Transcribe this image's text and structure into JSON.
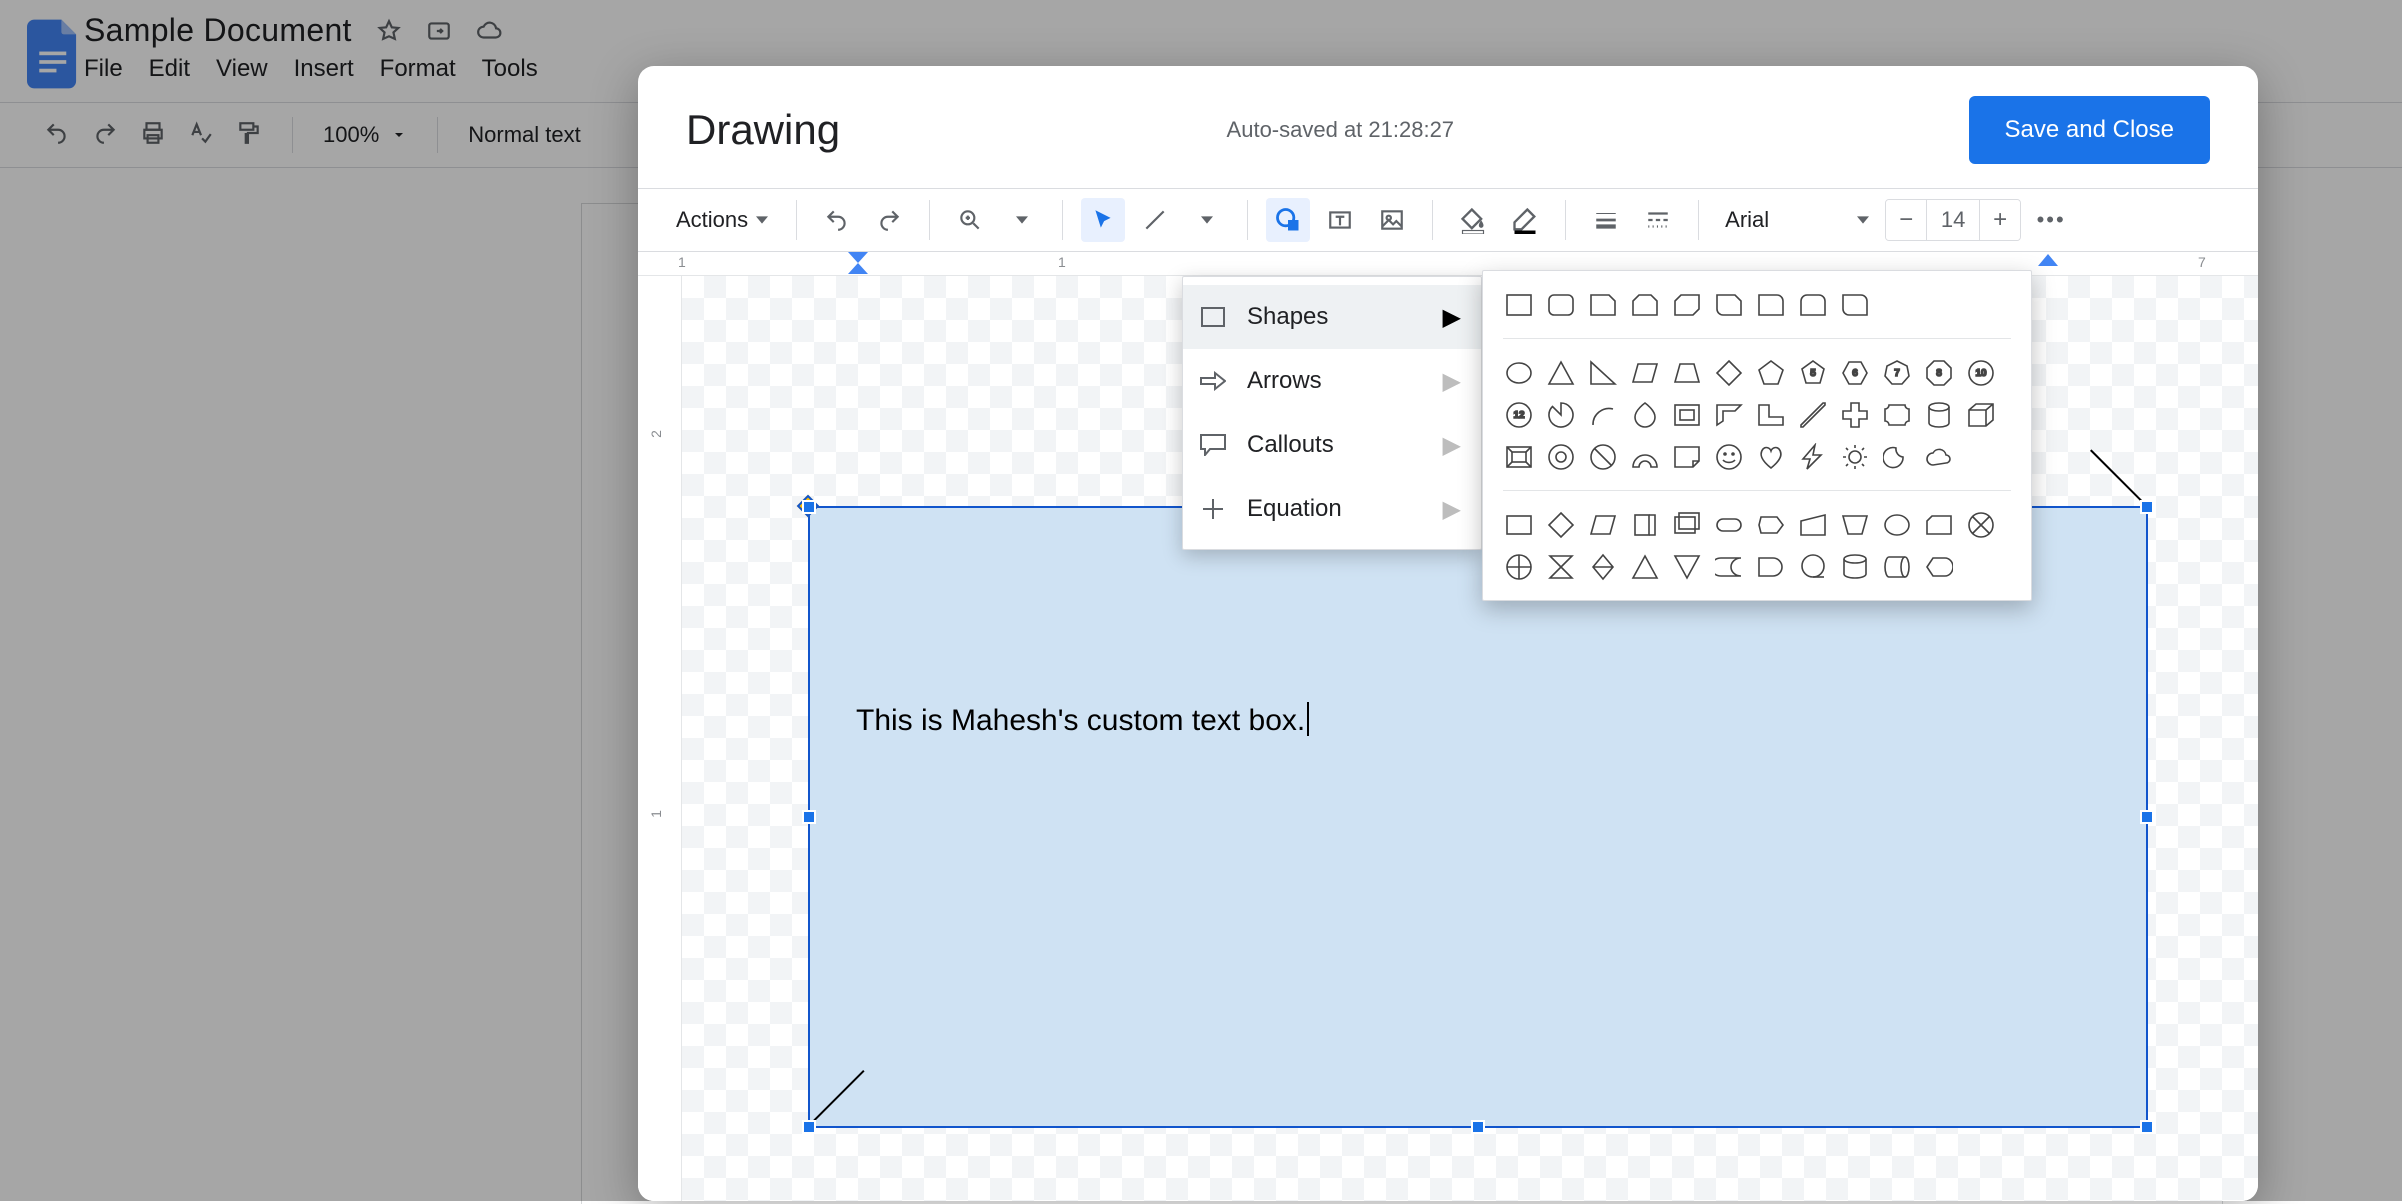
{
  "docs": {
    "title": "Sample Document",
    "menus": [
      "File",
      "Edit",
      "View",
      "Insert",
      "Format",
      "Tools"
    ],
    "zoom": "100%",
    "style": "Normal text"
  },
  "drawing": {
    "title": "Drawing",
    "status": "Auto-saved at 21:28:27",
    "save_label": "Save and Close",
    "actions_label": "Actions",
    "font": "Arial",
    "font_size": "14",
    "ruler": {
      "h": [
        "1",
        "1",
        "7"
      ],
      "v": [
        "2",
        "1"
      ]
    },
    "textbox_text": "This is Mahesh's custom text box."
  },
  "shape_menu": {
    "items": [
      {
        "label": "Shapes",
        "icon": "rect"
      },
      {
        "label": "Arrows",
        "icon": "arrow"
      },
      {
        "label": "Callouts",
        "icon": "callout"
      },
      {
        "label": "Equation",
        "icon": "plus"
      }
    ]
  },
  "shapes_flyout": {
    "polygon_badges": [
      "5",
      "6",
      "7",
      "8",
      "10",
      "12"
    ]
  }
}
